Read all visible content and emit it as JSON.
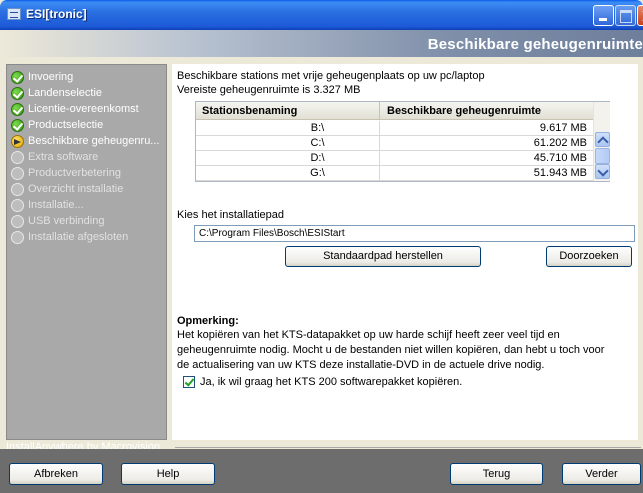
{
  "window": {
    "title": "ESI[tronic]",
    "controls": [
      "minimize",
      "maximize",
      "close"
    ]
  },
  "header": {
    "page_title": "Beschikbare geheugenruimte"
  },
  "steps": [
    {
      "label": "Invoering",
      "state": "done"
    },
    {
      "label": "Landenselectie",
      "state": "done"
    },
    {
      "label": "Licentie-overeenkomst",
      "state": "done"
    },
    {
      "label": "Productselectie",
      "state": "done"
    },
    {
      "label": "Beschikbare geheugenru...",
      "state": "current"
    },
    {
      "label": "Extra software",
      "state": "pending"
    },
    {
      "label": "Productverbetering",
      "state": "pending"
    },
    {
      "label": "Overzicht installatie",
      "state": "pending"
    },
    {
      "label": "Installatie...",
      "state": "pending"
    },
    {
      "label": "USB verbinding",
      "state": "pending"
    },
    {
      "label": "Installatie afgesloten",
      "state": "pending"
    }
  ],
  "main": {
    "intro_line1": "Beschikbare stations met vrije geheugenplaats op uw pc/laptop",
    "intro_line2": "Vereiste geheugenruimte is 3.327 MB",
    "table": {
      "columns": [
        "Stationsbenaming",
        "Beschikbare geheugenruimte"
      ],
      "rows": [
        {
          "drive": "B:\\",
          "space": "9.617  MB"
        },
        {
          "drive": "C:\\",
          "space": "61.202  MB"
        },
        {
          "drive": "D:\\",
          "space": "45.710  MB"
        },
        {
          "drive": "G:\\",
          "space": "51.943  MB"
        }
      ]
    },
    "path_label": "Kies het installatiepad",
    "path_value": "C:\\Program Files\\Bosch\\ESIStart",
    "restore_button": "Standaardpad herstellen",
    "browse_button": "Doorzoeken",
    "note_title": "Opmerking:",
    "note_line1": "Het kopiëren van het KTS-datapakket op uw harde schijf heeft zeer veel tijd en",
    "note_line2": "geheugenruimte nodig. Mocht u de bestanden niet willen kopiëren, dan hebt u toch voor",
    "note_line3": "de actualisering van uw KTS deze installatie-DVD in de actuele drive nodig.",
    "checkbox_label": "Ja, ik wil graag het KTS 200 softwarepakket kopiëren.",
    "checkbox_checked": true
  },
  "footer": {
    "brand_text": "InstallAnywhere by Macrovision",
    "buttons": {
      "abort": "Afbreken",
      "help": "Help",
      "back": "Terug",
      "next": "Verder"
    }
  }
}
